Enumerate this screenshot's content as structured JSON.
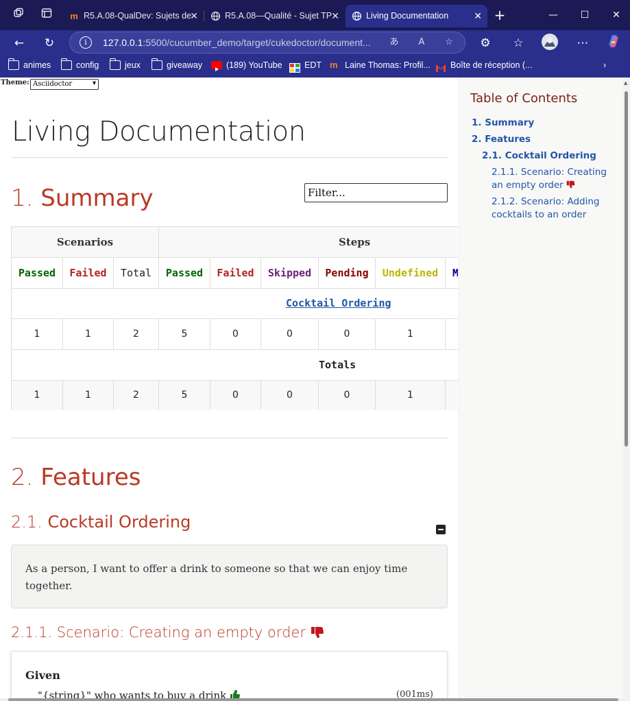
{
  "browser": {
    "tabs": [
      {
        "title": "R5.A.08-QualDev: Sujets de",
        "icon": "moodle-icon",
        "active": false
      },
      {
        "title": "R5.A.08—Qualité - Sujet TP",
        "icon": "globe-icon",
        "active": false
      },
      {
        "title": "Living Documentation",
        "icon": "globe-icon",
        "active": true
      }
    ],
    "new_tab": "+",
    "window_controls": {
      "minimize": "—",
      "maximize": "☐",
      "close": "✕"
    },
    "url": {
      "host": "127.0.0.1",
      "rest": ":5500/cucumber_demo/target/cukedoctor/document..."
    },
    "bookmarks": [
      {
        "label": "animes",
        "icon": "folder-icon"
      },
      {
        "label": "config",
        "icon": "folder-icon"
      },
      {
        "label": "jeux",
        "icon": "folder-icon"
      },
      {
        "label": "giveaway",
        "icon": "folder-icon"
      },
      {
        "label": "(189) YouTube",
        "icon": "youtube-icon"
      },
      {
        "label": "EDT",
        "icon": "edt-icon"
      },
      {
        "label": "Laine Thomas: Profil...",
        "icon": "moodle-icon"
      },
      {
        "label": "Boîte de réception (...",
        "icon": "gmail-icon"
      }
    ]
  },
  "page": {
    "theme_label": "Theme:",
    "theme_value": "Asciidoctor",
    "title": "Living Documentation",
    "summary_heading_num": "1.",
    "summary_heading": "Summary",
    "filter_placeholder": "Filter...",
    "table": {
      "group_scenarios": "Scenarios",
      "group_steps": "Steps",
      "columns": [
        "Passed",
        "Failed",
        "Total",
        "Passed",
        "Failed",
        "Skipped",
        "Pending",
        "Undefined",
        "M"
      ],
      "column_colors": [
        "#006400",
        "#b22222",
        "#222222",
        "#006400",
        "#b22222",
        "#6b1f78",
        "#8b0000",
        "#b8b800",
        "#00008b"
      ],
      "feature_link": "Cocktail Ordering",
      "feature_row": [
        "1",
        "1",
        "2",
        "5",
        "0",
        "0",
        "0",
        "1",
        ""
      ],
      "totals_label": "Totals",
      "totals_row": [
        "1",
        "1",
        "2",
        "5",
        "0",
        "0",
        "0",
        "1",
        ""
      ]
    },
    "features_heading_num": "2.",
    "features_heading": "Features",
    "feature_num": "2.1.",
    "feature_title": "Cocktail Ordering",
    "feature_description": "As a person, I want to offer a drink to someone so that we can enjoy time together.",
    "scenario_num": "2.1.1.",
    "scenario_title": "Scenario: Creating an empty order",
    "step_keyword": "Given",
    "step_text": "\"{string}\" who wants to buy a drink",
    "step_time": "(001ms)"
  },
  "toc": {
    "title": "Table of Contents",
    "items": [
      {
        "label": "1. Summary"
      },
      {
        "label": "2. Features"
      },
      {
        "label": "2.1. Cocktail Ordering"
      },
      {
        "label_line1": "2.1.1. Scenario: Creating",
        "label_line2": "an empty order"
      },
      {
        "label_line1": "2.1.2. Scenario: Adding",
        "label_line2": "cocktails to an order"
      }
    ]
  }
}
